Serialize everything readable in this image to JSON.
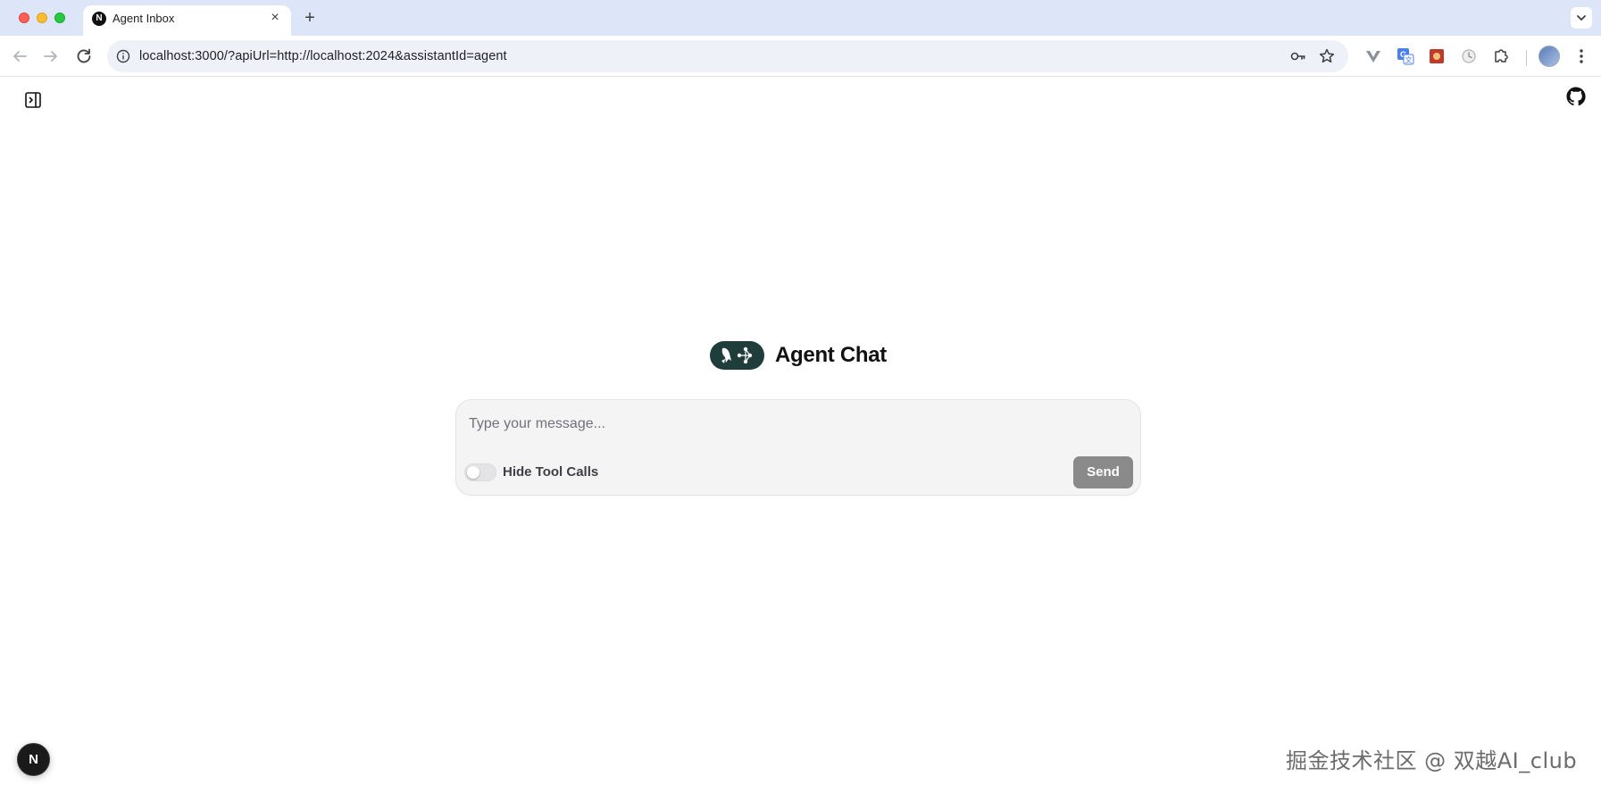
{
  "browser": {
    "tab": {
      "title": "Agent Inbox",
      "favicon_letter": "N",
      "close_glyph": "×"
    },
    "new_tab_glyph": "+",
    "address_bar": {
      "url": "localhost:3000/?apiUrl=http://localhost:2024&assistantId=agent"
    },
    "icons": {
      "back": "arrow-left-icon",
      "forward": "arrow-right-icon",
      "reload": "reload-icon",
      "site_info": "info-icon",
      "password": "key-icon",
      "bookmark": "star-icon",
      "extensions": "puzzle-icon",
      "menu": "kebab-menu-icon"
    }
  },
  "page": {
    "brand": {
      "title": "Agent Chat"
    },
    "composer": {
      "placeholder": "Type your message...",
      "toggle_label": "Hide Tool Calls",
      "toggle_on": false,
      "send_label": "Send"
    },
    "next_badge": "N",
    "watermark": "掘金技术社区 @ 双越AI_club"
  },
  "colors": {
    "tabstrip": "#dce6f8",
    "brand_logo_bg": "#1f3d3b",
    "send_button": "#8a8a8a",
    "composer_bg": "#f4f4f5"
  }
}
